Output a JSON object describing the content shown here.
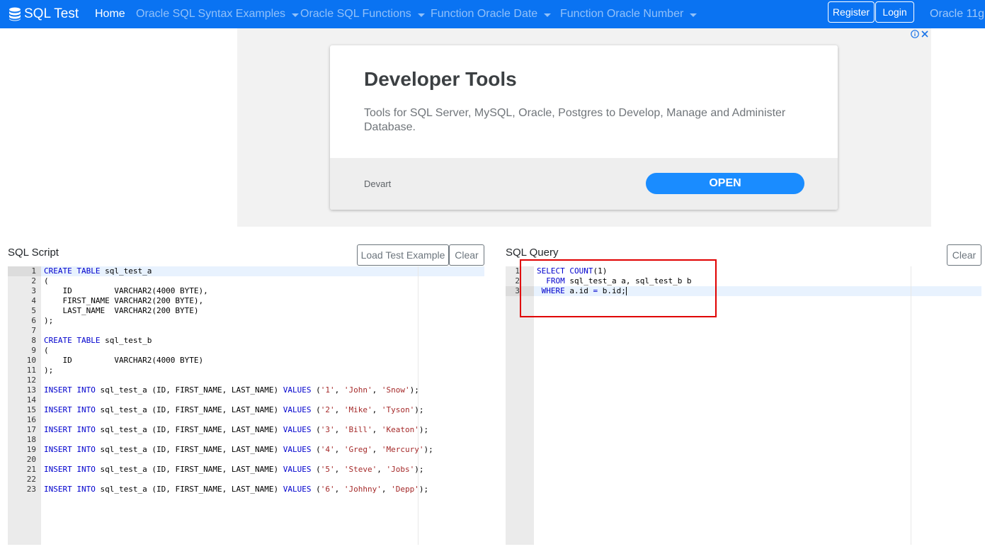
{
  "navbar": {
    "brand": "SQL Test",
    "links": [
      {
        "label": "Home",
        "dropdown": false
      },
      {
        "label": "Oracle SQL Syntax Examples",
        "dropdown": true
      },
      {
        "label": "Oracle SQL Functions",
        "dropdown": true
      },
      {
        "label": "Function Oracle Date",
        "dropdown": true
      },
      {
        "label": "Function Oracle Number",
        "dropdown": true
      }
    ],
    "register_label": "Register",
    "login_label": "Login",
    "db_selector": "Oracle 11g"
  },
  "ad": {
    "title": "Developer Tools",
    "description": "Tools for SQL Server, MySQL, Oracle, Postgres to Develop, Manage and Administer Database.",
    "sponsor": "Devart",
    "cta": "OPEN"
  },
  "script_panel": {
    "title": "SQL Script",
    "load_example_label": "Load Test Example",
    "clear_label": "Clear",
    "lines": [
      [
        {
          "t": "CREATE TABLE",
          "c": "kw"
        },
        {
          "t": " sql_test_a"
        }
      ],
      [
        {
          "t": "("
        }
      ],
      [
        {
          "t": "    ID         VARCHAR2(4000 BYTE),"
        }
      ],
      [
        {
          "t": "    FIRST_NAME VARCHAR2(200 BYTE),"
        }
      ],
      [
        {
          "t": "    LAST_NAME  VARCHAR2(200 BYTE)"
        }
      ],
      [
        {
          "t": ");"
        }
      ],
      [],
      [
        {
          "t": "CREATE TABLE",
          "c": "kw"
        },
        {
          "t": " sql_test_b"
        }
      ],
      [
        {
          "t": "("
        }
      ],
      [
        {
          "t": "    ID         VARCHAR2(4000 BYTE)"
        }
      ],
      [
        {
          "t": ");"
        }
      ],
      [],
      [
        {
          "t": "INSERT INTO",
          "c": "kw"
        },
        {
          "t": " sql_test_a (ID, FIRST_NAME, LAST_NAME) "
        },
        {
          "t": "VALUES",
          "c": "kw"
        },
        {
          "t": " ("
        },
        {
          "t": "'1'",
          "c": "str"
        },
        {
          "t": ", "
        },
        {
          "t": "'John'",
          "c": "str"
        },
        {
          "t": ", "
        },
        {
          "t": "'Snow'",
          "c": "str"
        },
        {
          "t": ");"
        }
      ],
      [],
      [
        {
          "t": "INSERT INTO",
          "c": "kw"
        },
        {
          "t": " sql_test_a (ID, FIRST_NAME, LAST_NAME) "
        },
        {
          "t": "VALUES",
          "c": "kw"
        },
        {
          "t": " ("
        },
        {
          "t": "'2'",
          "c": "str"
        },
        {
          "t": ", "
        },
        {
          "t": "'Mike'",
          "c": "str"
        },
        {
          "t": ", "
        },
        {
          "t": "'Tyson'",
          "c": "str"
        },
        {
          "t": ");"
        }
      ],
      [],
      [
        {
          "t": "INSERT INTO",
          "c": "kw"
        },
        {
          "t": " sql_test_a (ID, FIRST_NAME, LAST_NAME) "
        },
        {
          "t": "VALUES",
          "c": "kw"
        },
        {
          "t": " ("
        },
        {
          "t": "'3'",
          "c": "str"
        },
        {
          "t": ", "
        },
        {
          "t": "'Bill'",
          "c": "str"
        },
        {
          "t": ", "
        },
        {
          "t": "'Keaton'",
          "c": "str"
        },
        {
          "t": ");"
        }
      ],
      [],
      [
        {
          "t": "INSERT INTO",
          "c": "kw"
        },
        {
          "t": " sql_test_a (ID, FIRST_NAME, LAST_NAME) "
        },
        {
          "t": "VALUES",
          "c": "kw"
        },
        {
          "t": " ("
        },
        {
          "t": "'4'",
          "c": "str"
        },
        {
          "t": ", "
        },
        {
          "t": "'Greg'",
          "c": "str"
        },
        {
          "t": ", "
        },
        {
          "t": "'Mercury'",
          "c": "str"
        },
        {
          "t": ");"
        }
      ],
      [],
      [
        {
          "t": "INSERT INTO",
          "c": "kw"
        },
        {
          "t": " sql_test_a (ID, FIRST_NAME, LAST_NAME) "
        },
        {
          "t": "VALUES",
          "c": "kw"
        },
        {
          "t": " ("
        },
        {
          "t": "'5'",
          "c": "str"
        },
        {
          "t": ", "
        },
        {
          "t": "'Steve'",
          "c": "str"
        },
        {
          "t": ", "
        },
        {
          "t": "'Jobs'",
          "c": "str"
        },
        {
          "t": ");"
        }
      ],
      [],
      [
        {
          "t": "INSERT INTO",
          "c": "kw"
        },
        {
          "t": " sql_test_a (ID, FIRST_NAME, LAST_NAME) "
        },
        {
          "t": "VALUES",
          "c": "kw"
        },
        {
          "t": " ("
        },
        {
          "t": "'6'",
          "c": "str"
        },
        {
          "t": ", "
        },
        {
          "t": "'Johhny'",
          "c": "str"
        },
        {
          "t": ", "
        },
        {
          "t": "'Depp'",
          "c": "str"
        },
        {
          "t": ");"
        }
      ]
    ]
  },
  "query_panel": {
    "title": "SQL Query",
    "clear_label": "Clear",
    "lines": [
      [
        {
          "t": "SELECT",
          "c": "kw"
        },
        {
          "t": " "
        },
        {
          "t": "COUNT",
          "c": "kw"
        },
        {
          "t": "(1)"
        }
      ],
      [
        {
          "t": "  "
        },
        {
          "t": "FROM",
          "c": "kw"
        },
        {
          "t": " sql_test_a a, sql_test_b b"
        }
      ],
      [
        {
          "t": " "
        },
        {
          "t": "WHERE",
          "c": "kw"
        },
        {
          "t": " a.id "
        },
        {
          "t": "=",
          "c": "kw"
        },
        {
          "t": " b.id;"
        }
      ]
    ]
  },
  "colors": {
    "navbar_bg": "#0a73f2",
    "keyword": "#0000cd",
    "string": "#a52a2a",
    "highlight_box": "#e00000"
  }
}
